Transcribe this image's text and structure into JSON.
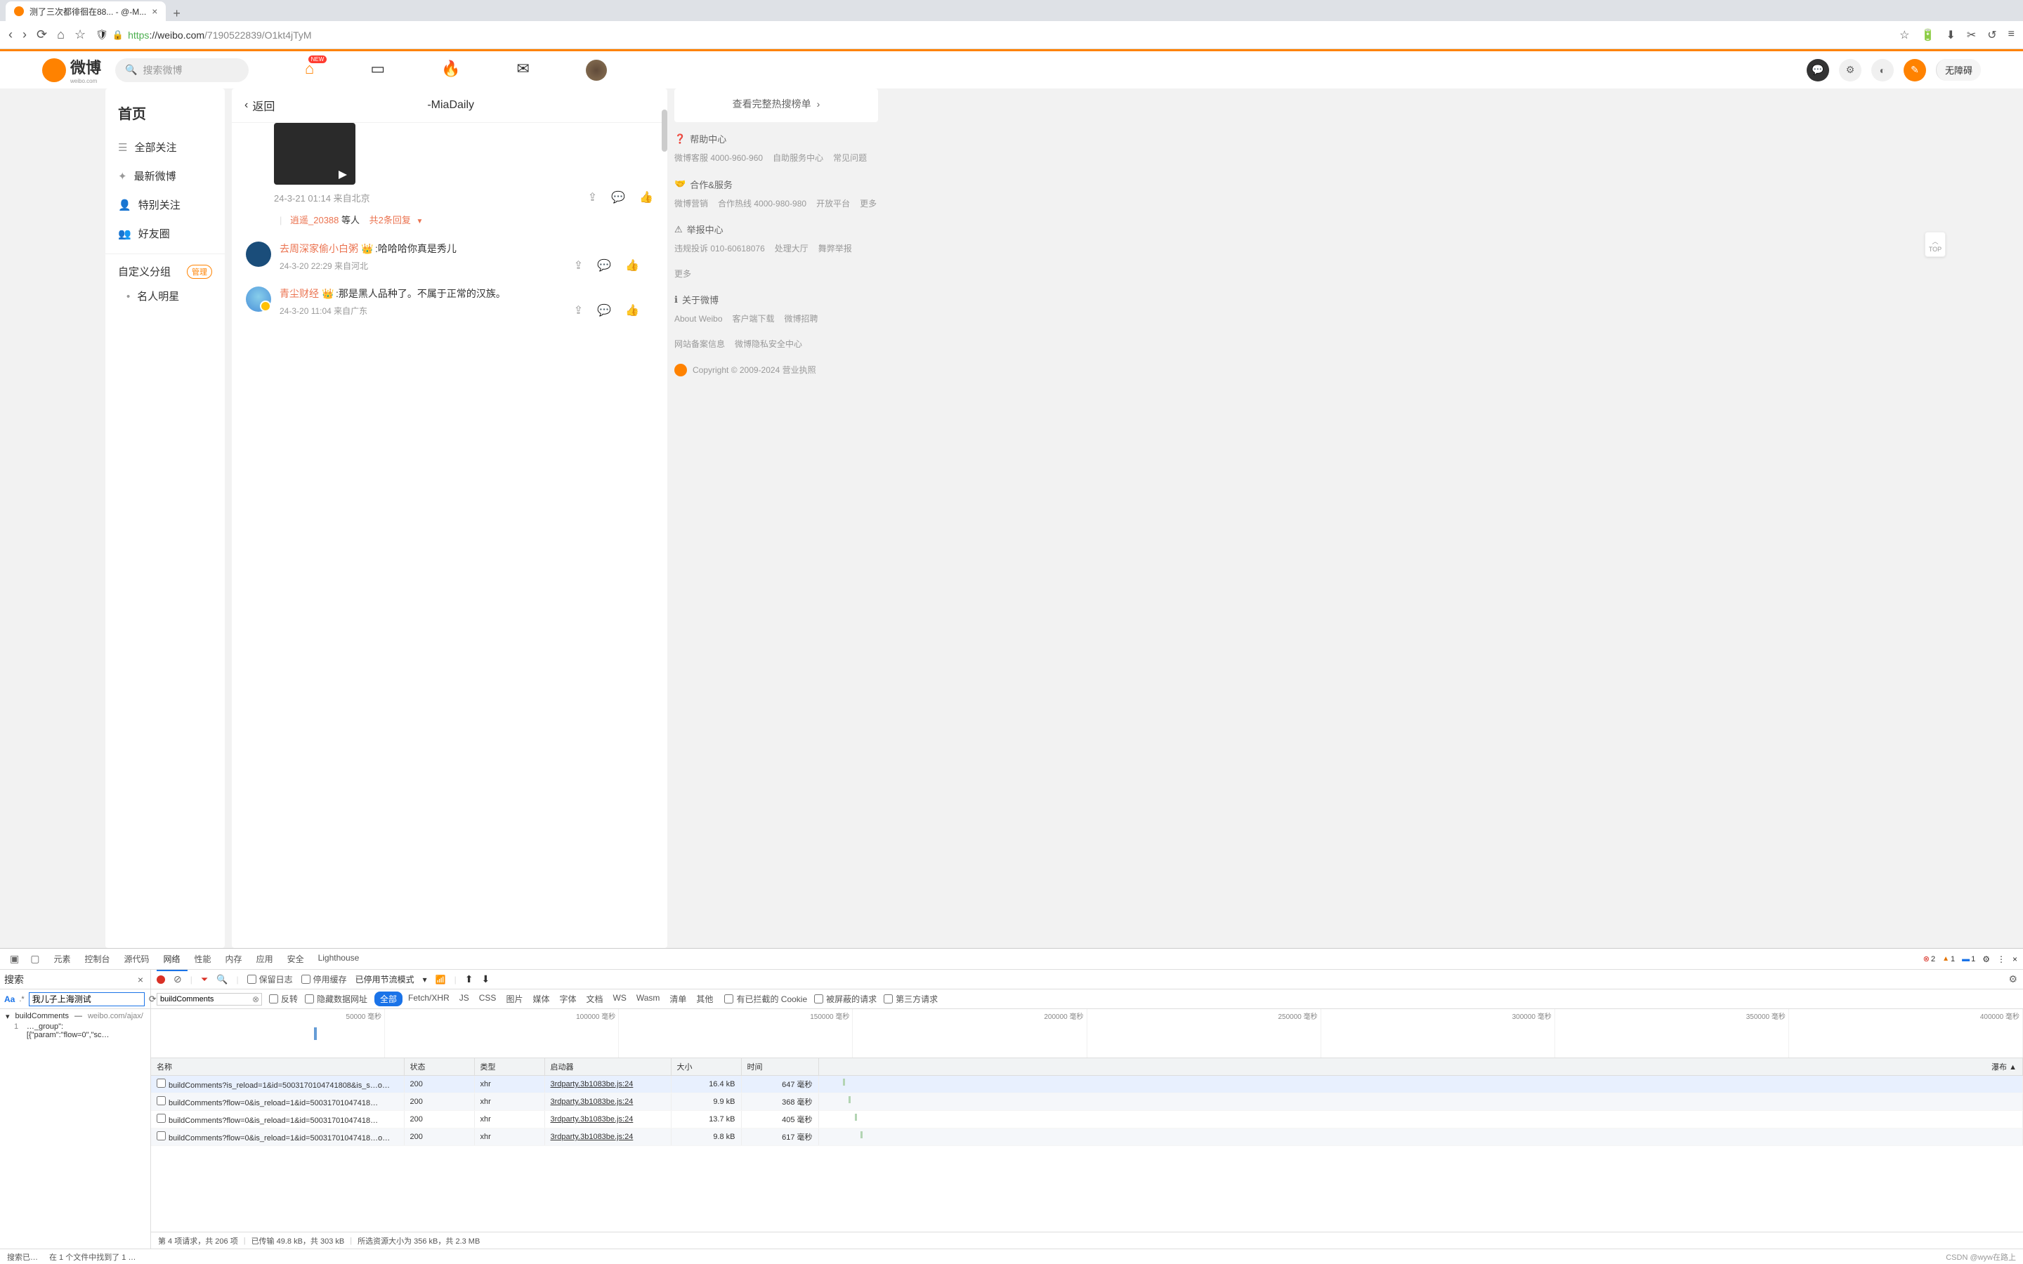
{
  "browser": {
    "tab_title": "测了三次都徘徊在88... - @-M...",
    "url_proto": "https",
    "url_host": "://weibo.com",
    "url_path": "/7190522839/O1kt4jTyM"
  },
  "weibo_header": {
    "logo_text": "微博",
    "logo_sub": "weibo.com",
    "search_placeholder": "搜索微博",
    "nav_badge": "NEW",
    "a11y": "无障碍"
  },
  "sidebar": {
    "title": "首页",
    "items": [
      "全部关注",
      "最新微博",
      "特别关注",
      "好友圈"
    ],
    "section": "自定义分组",
    "manage": "管理",
    "sub_items": [
      "名人明星"
    ]
  },
  "main": {
    "back": "返回",
    "title": "-MiaDaily",
    "post_meta": "24-3-21 01:14 来自北京",
    "reply_user": "逍遥_20388",
    "reply_etc": "等人",
    "reply_count": "共2条回复",
    "comments": [
      {
        "name": "去周深家偷小白粥",
        "text": ":哈哈哈你真是秀儿",
        "meta": "24-3-20 22:29 来自河北"
      },
      {
        "name": "青尘财经",
        "text": ":那是黑人品种了。不属于正常的汉族。",
        "meta": "24-3-20 11:04 来自广东"
      }
    ]
  },
  "right": {
    "hotlist": "查看完整热搜榜单",
    "sections": [
      {
        "title": "帮助中心",
        "links": [
          "微博客服 4000-960-960",
          "自助服务中心",
          "常见问题"
        ]
      },
      {
        "title": "合作&服务",
        "links": [
          "微博营销",
          "合作热线 4000-980-980",
          "开放平台",
          "更多"
        ]
      },
      {
        "title": "举报中心",
        "links": [
          "违规投诉 010-60618076",
          "处理大厅",
          "舞弊举报",
          "更多"
        ]
      },
      {
        "title": "关于微博",
        "links": [
          "About Weibo",
          "客户端下载",
          "微博招聘",
          "网站备案信息",
          "微博隐私安全中心"
        ]
      }
    ],
    "copyright": "Copyright © 2009-2024 营业执照",
    "top": "TOP"
  },
  "devtools": {
    "tabs": [
      "元素",
      "控制台",
      "源代码",
      "网络",
      "性能",
      "内存",
      "应用",
      "安全",
      "Lighthouse"
    ],
    "active_tab": "网络",
    "err_count": "2",
    "warn_count": "1",
    "info_count": "1",
    "search_label": "搜索",
    "search_value": "我儿子上海测试",
    "search_result_name": "buildComments",
    "search_result_src": "weibo.com/ajax/",
    "search_match_line": "1",
    "search_match_text": "…_group\":[{\"param\":\"flow=0\",\"sc…",
    "net_preserve": "保留日志",
    "net_cache": "停用缓存",
    "net_throttle": "已停用节流模式",
    "filter_value": "buildComments",
    "filter_invert": "反转",
    "filter_hide": "隐藏数据网址",
    "filter_types": [
      "全部",
      "Fetch/XHR",
      "JS",
      "CSS",
      "图片",
      "媒体",
      "字体",
      "文档",
      "WS",
      "Wasm",
      "清单",
      "其他"
    ],
    "filter_blocked": "有已拦截的 Cookie",
    "filter_blocked_req": "被屏蔽的请求",
    "filter_3rd": "第三方请求",
    "timeline_labels": [
      "50000 毫秒",
      "100000 毫秒",
      "150000 毫秒",
      "200000 毫秒",
      "250000 毫秒",
      "300000 毫秒",
      "350000 毫秒",
      "400000 毫秒"
    ],
    "table_headers": [
      "名称",
      "状态",
      "类型",
      "启动器",
      "大小",
      "时间",
      "瀑布"
    ],
    "table_sort_indicator": "▲",
    "rows": [
      {
        "name": "buildComments?is_reload=1&id=5003170104741808&is_s…o…",
        "status": "200",
        "type": "xhr",
        "initiator": "3rdparty.3b1083be.js:24",
        "size": "16.4 kB",
        "time": "647 毫秒"
      },
      {
        "name": "buildComments?flow=0&is_reload=1&id=50031701047418…",
        "status": "200",
        "type": "xhr",
        "initiator": "3rdparty.3b1083be.js:24",
        "size": "9.9 kB",
        "time": "368 毫秒"
      },
      {
        "name": "buildComments?flow=0&is_reload=1&id=50031701047418…",
        "status": "200",
        "type": "xhr",
        "initiator": "3rdparty.3b1083be.js:24",
        "size": "13.7 kB",
        "time": "405 毫秒"
      },
      {
        "name": "buildComments?flow=0&is_reload=1&id=50031701047418…o…",
        "status": "200",
        "type": "xhr",
        "initiator": "3rdparty.3b1083be.js:24",
        "size": "9.8 kB",
        "time": "617 毫秒"
      }
    ],
    "status_requests": "第 4 项请求，共 206 项",
    "status_transfer": "已传输 49.8 kB，共 303 kB",
    "status_resources": "所选资源大小为 356 kB，共 2.3 MB",
    "footer_search": "搜索已…",
    "footer_found": "在 1 个文件中找到了 1 …",
    "footer_watermark": "CSDN @wyw在路上"
  }
}
